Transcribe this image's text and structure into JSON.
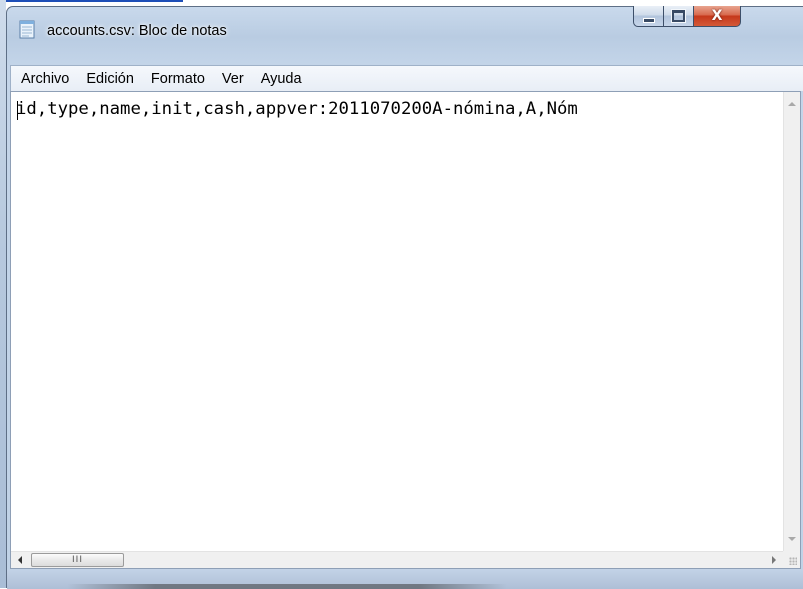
{
  "window": {
    "title": "accounts.csv: Bloc de notas",
    "icon": "notepad-icon",
    "caption_buttons": {
      "minimize_icon": "minimize-icon",
      "maximize_icon": "maximize-icon",
      "close_glyph": "X"
    },
    "accent_close_color": "#c5381b"
  },
  "menubar": {
    "items": [
      {
        "label": "Archivo"
      },
      {
        "label": "Edición"
      },
      {
        "label": "Formato"
      },
      {
        "label": "Ver"
      },
      {
        "label": "Ayuda"
      }
    ]
  },
  "editor": {
    "content": "id,type,name,init,cash,appver:2011070200A-nómina,A,Nóm"
  },
  "hscroll": {
    "thumb_grip": "III"
  }
}
